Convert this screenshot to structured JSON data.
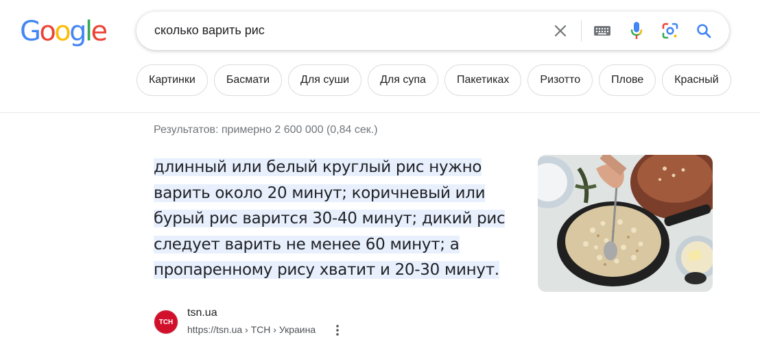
{
  "logo": {
    "letters": [
      "G",
      "o",
      "o",
      "g",
      "l",
      "e"
    ],
    "colors": [
      "#4285F4",
      "#EA4335",
      "#FBBC05",
      "#4285F4",
      "#34A853",
      "#EA4335"
    ]
  },
  "search": {
    "query": "сколько варить рис",
    "icons": [
      "close-icon",
      "keyboard-icon",
      "microphone-icon",
      "lens-icon",
      "search-icon"
    ]
  },
  "chips": [
    "Картинки",
    "Басмати",
    "Для суши",
    "Для супа",
    "Пакетиках",
    "Ризотто",
    "Плове",
    "Красный"
  ],
  "results_stats": "Результатов: примерно 2 600 000 (0,84 сек.)",
  "snippet": {
    "lines": [
      "длинный или белый круглый рис нужно",
      "варить около 20 минут; коричневый или",
      "бурый рис варится 30-40 минут; дикий рис",
      "следует варить не менее 60 минут; а",
      "пропаренному рису хватит и 20-30 минут."
    ]
  },
  "source": {
    "favicon_text": "ТСН",
    "site_name": "tsn.ua",
    "url": "https://tsn.ua › ТСН › Украина"
  },
  "colors": {
    "highlight": "#e8f0fe",
    "favicon_bg": "#d1112c",
    "search_blue": "#4285F4"
  }
}
